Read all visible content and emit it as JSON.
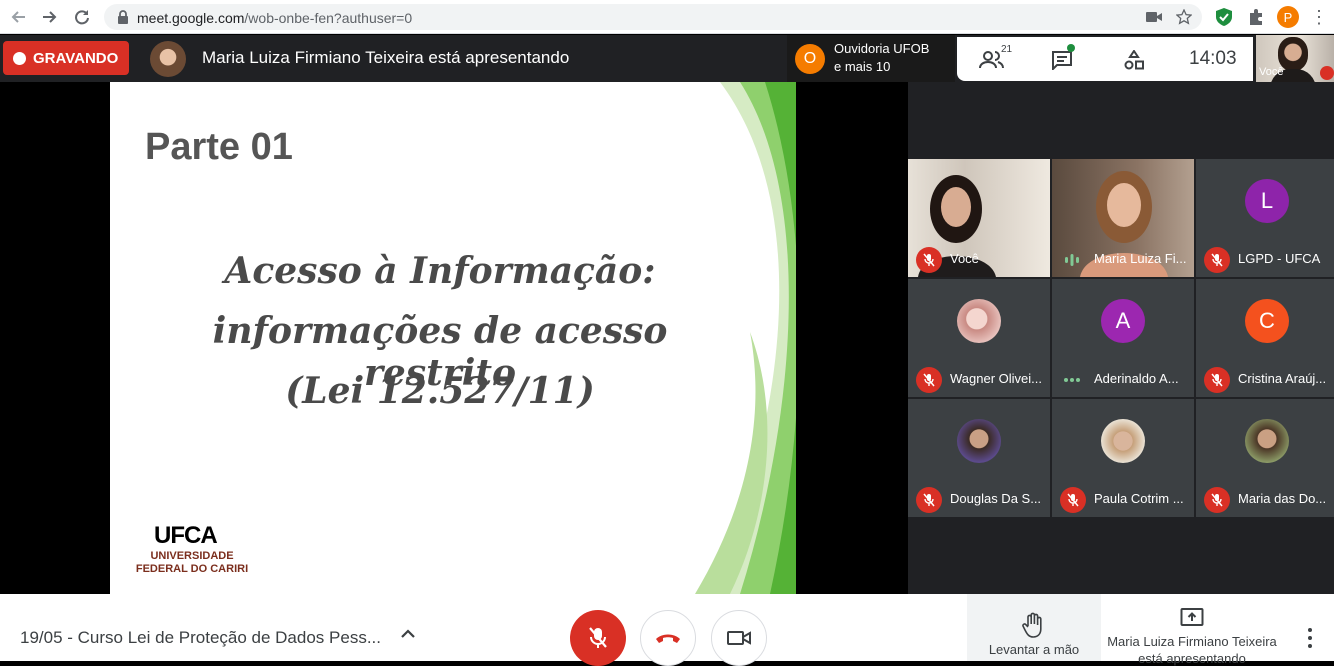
{
  "browser": {
    "url_host": "meet.google.com",
    "url_path": "/wob-onbe-fen?authuser=0",
    "profile_initial": "P"
  },
  "topbar": {
    "recording_label": "GRAVANDO",
    "presenting_text": "Maria Luiza Firmiano Teixeira está apresentando",
    "notification": {
      "initial": "O",
      "line1": "Ouvidoria UFOB",
      "line2": "e mais 10"
    },
    "people_count": "21",
    "time": "14:03",
    "self_label": "Você"
  },
  "slide": {
    "kicker": "Parte 01",
    "title_line1": "Acesso à Informação:",
    "title_line2": "informações de acesso restrito",
    "title_line3": "(Lei 12.527/11)",
    "logo_text": "UFCA",
    "logo_line1": "UNIVERSIDADE",
    "logo_line2": "FEDERAL DO CARIRI"
  },
  "participants": [
    {
      "name": "Você",
      "kind": "video",
      "muted": true
    },
    {
      "name": "Maria Luiza Fi...",
      "kind": "video",
      "muted": false,
      "speaking": true
    },
    {
      "name": "LGPD - UFCA",
      "kind": "initial",
      "initial": "L",
      "color": "#8e24aa",
      "muted": true
    },
    {
      "name": "Wagner Olivei...",
      "kind": "photo",
      "muted": true
    },
    {
      "name": "Aderinaldo A...",
      "kind": "initial",
      "initial": "A",
      "color": "#9c27b0",
      "muted": false
    },
    {
      "name": "Cristina Araúj...",
      "kind": "initial",
      "initial": "C",
      "color": "#f4511e",
      "muted": true
    },
    {
      "name": "Douglas Da S...",
      "kind": "photo",
      "muted": true
    },
    {
      "name": "Paula Cotrim ...",
      "kind": "photo",
      "muted": true
    },
    {
      "name": "Maria das Do...",
      "kind": "photo",
      "muted": true
    }
  ],
  "bottombar": {
    "meeting_title": "19/05 - Curso Lei de Proteção de Dados Pess...",
    "raise_hand_label": "Levantar a mão",
    "presenting_line1": "Maria Luiza Firmiano Teixeira",
    "presenting_line2": "está apresentando"
  },
  "colors": {
    "record_red": "#d93025",
    "meet_dark": "#202124",
    "slide_green": "#6abf4b"
  }
}
